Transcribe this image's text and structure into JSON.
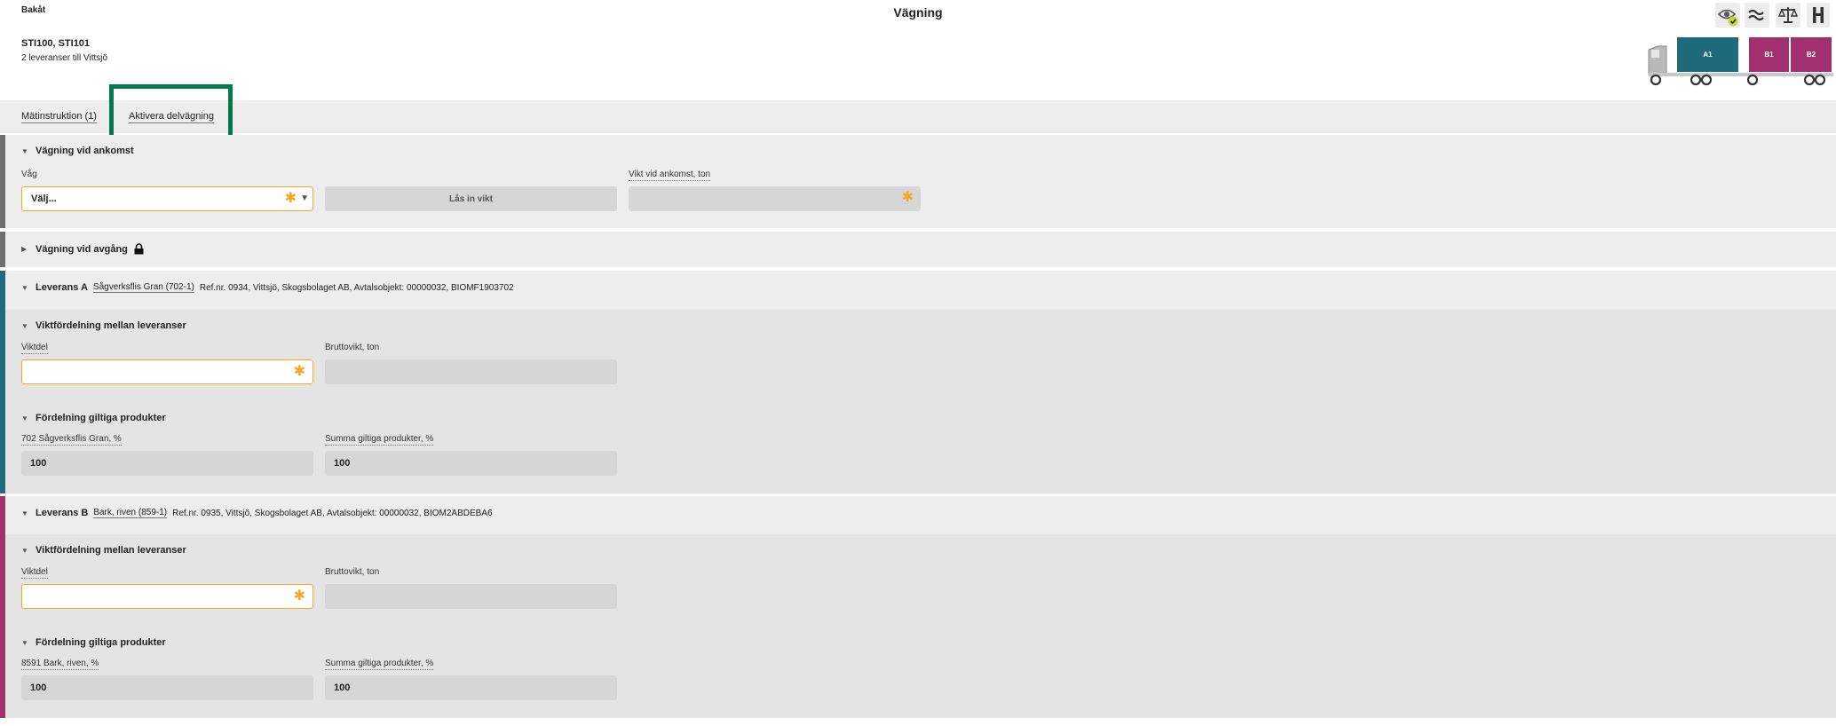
{
  "header": {
    "back_label": "Bakåt",
    "title": "Vägning",
    "vehicle_ids": "STI100, STI101",
    "delivery_count": "2 leveranser till Vittsjö"
  },
  "toolbar": {
    "icons": [
      "eye-check-icon",
      "wave-icon",
      "scale-icon",
      "grip-icon"
    ]
  },
  "truck": {
    "cargo": [
      {
        "label": "A1",
        "color": "#1e6b7b"
      },
      {
        "label": "B1",
        "color": "#a3306e"
      },
      {
        "label": "B2",
        "color": "#a3306e"
      }
    ]
  },
  "tabs": {
    "measurement": "Mätinstruktion (1)",
    "partial_weighing": "Aktivera delvägning"
  },
  "arrival": {
    "heading": "Vägning vid ankomst",
    "scale_label": "Våg",
    "scale_value": "Välj...",
    "lock_button": "Lås in vikt",
    "weight_label": "Vikt vid ankomst, ton"
  },
  "departure": {
    "heading": "Vägning vid avgång"
  },
  "delivery_a": {
    "name": "Leverans A",
    "product_link": "Sågverksflis Gran (702-1)",
    "details": "Ref.nr. 0934,  Vittsjö, Skogsbolaget AB, Avtalsobjekt: 00000032, BIOMF1903702",
    "weight_heading": "Viktfördelning mellan leveranser",
    "share_label": "Viktdel",
    "gross_label": "Bruttovikt, ton",
    "products_heading": "Fördelning giltiga produkter",
    "product_pct_label": "702 Sågverksflis Gran, %",
    "product_pct_value": "100",
    "sum_label": "Summa giltiga produkter, %",
    "sum_value": "100"
  },
  "delivery_b": {
    "name": "Leverans B",
    "product_link": "Bark, riven (859-1)",
    "details": "Ref.nr. 0935,  Vittsjö, Skogsbolaget AB, Avtalsobjekt: 00000032, BIOM2ABDEBA6",
    "weight_heading": "Viktfördelning mellan leveranser",
    "share_label": "Viktdel",
    "gross_label": "Bruttovikt, ton",
    "products_heading": "Fördelning giltiga produkter",
    "product_pct_label": "8591 Bark, riven, %",
    "product_pct_value": "100",
    "sum_label": "Summa giltiga produkter, %",
    "sum_value": "100"
  },
  "colors": {
    "accent_green": "#007a4d",
    "required_orange": "#f5a623",
    "delivery_a": "#1e6b7b",
    "delivery_b": "#a3306e",
    "weighing_stripe": "#6e6e6e"
  }
}
